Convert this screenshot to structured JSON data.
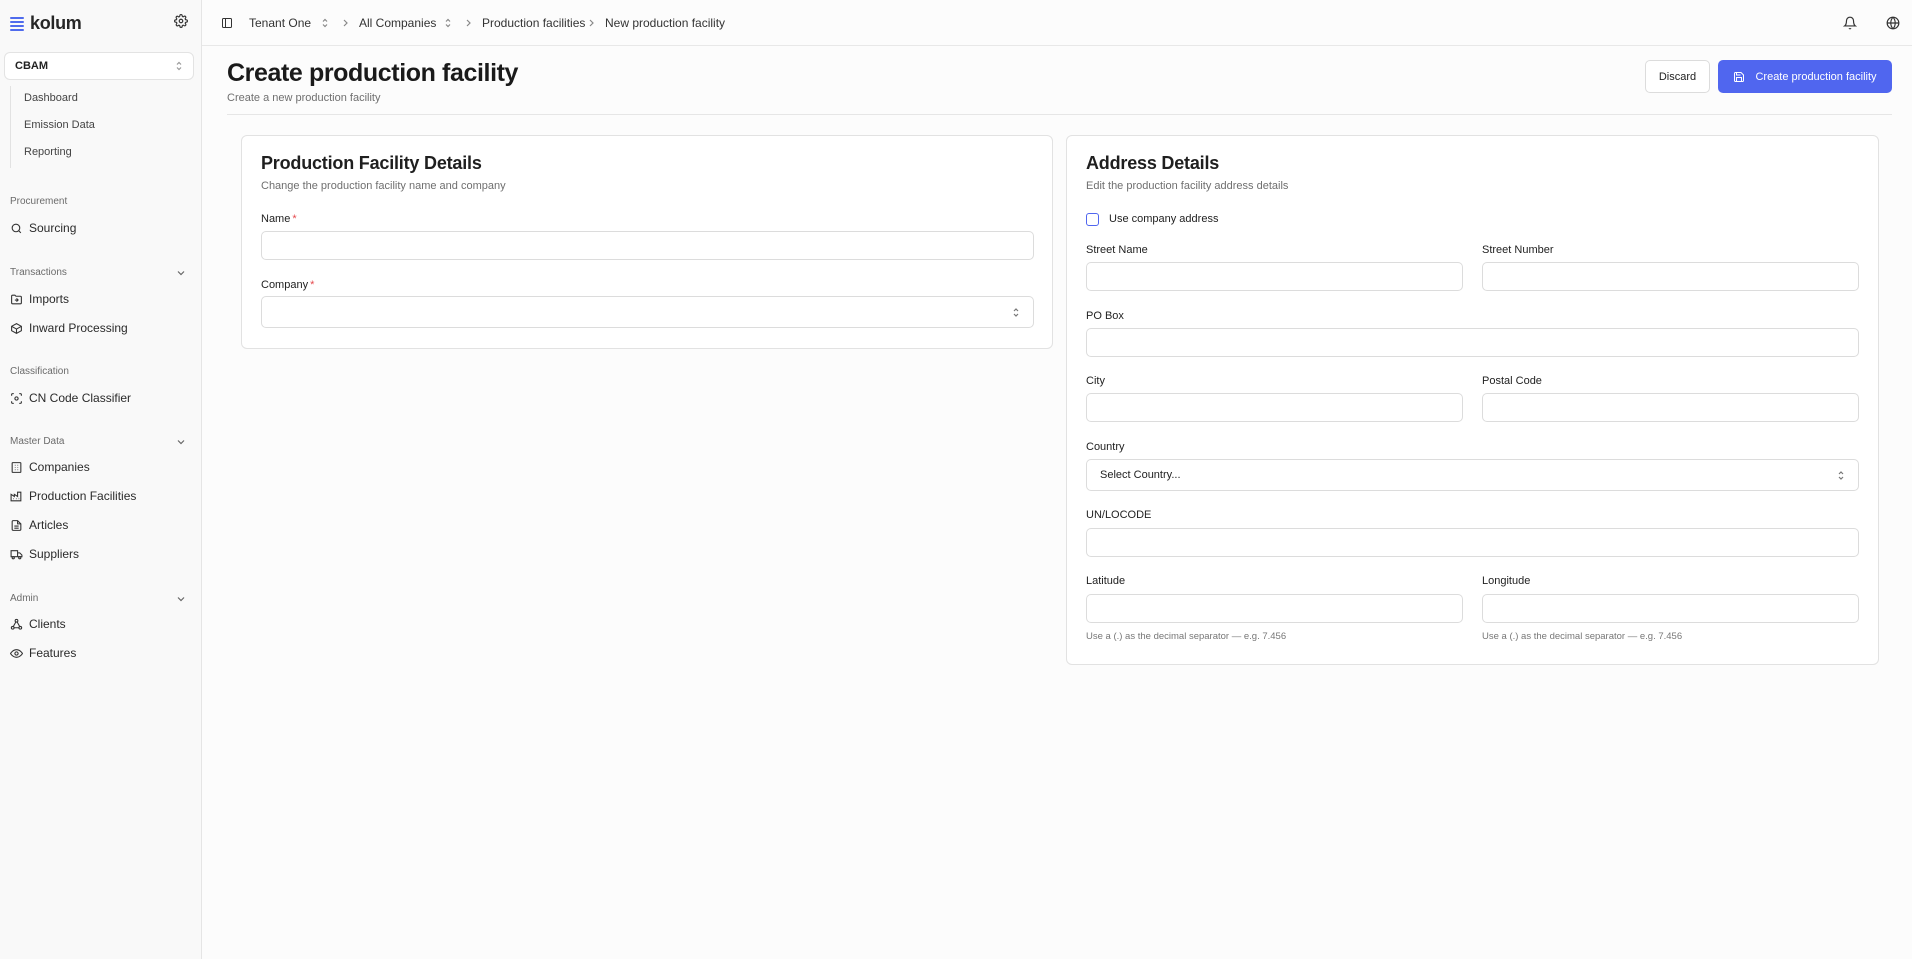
{
  "app": {
    "brand": "kolum",
    "accent": "#5066ef"
  },
  "sidebar": {
    "workspace": "CBAM",
    "sub_items": [
      "Dashboard",
      "Emission Data",
      "Reporting"
    ],
    "sections": [
      {
        "title": "Procurement",
        "items": [
          {
            "label": "Sourcing",
            "icon": "search-icon"
          }
        ]
      },
      {
        "title": "Transactions",
        "items": [
          {
            "label": "Imports",
            "icon": "folder-import-icon"
          },
          {
            "label": "Inward Processing",
            "icon": "package-icon"
          }
        ]
      },
      {
        "title": "Classification",
        "items": [
          {
            "label": "CN Code Classifier",
            "icon": "scan-icon"
          }
        ]
      },
      {
        "title": "Master Data",
        "items": [
          {
            "label": "Companies",
            "icon": "building-icon"
          },
          {
            "label": "Production Facilities",
            "icon": "factory-icon"
          },
          {
            "label": "Articles",
            "icon": "document-icon"
          },
          {
            "label": "Suppliers",
            "icon": "truck-icon"
          }
        ]
      },
      {
        "title": "Admin",
        "items": [
          {
            "label": "Clients",
            "icon": "network-icon"
          },
          {
            "label": "Features",
            "icon": "eye-icon"
          }
        ]
      }
    ]
  },
  "topbar": {
    "breadcrumbs": [
      "Tenant One",
      "All Companies",
      "Production facilities",
      "New production facility"
    ]
  },
  "header": {
    "title": "Create production facility",
    "subtitle": "Create a new production facility",
    "discard_label": "Discard",
    "create_label": "Create production facility"
  },
  "facility_card": {
    "title": "Production Facility Details",
    "description": "Change the production facility name and company",
    "name_label": "Name",
    "company_label": "Company",
    "name_value": "",
    "company_value": ""
  },
  "address_card": {
    "title": "Address Details",
    "description": "Edit the production facility address details",
    "use_company_address_label": "Use company address",
    "use_company_address_checked": false,
    "street_name_label": "Street Name",
    "street_number_label": "Street Number",
    "po_box_label": "PO Box",
    "city_label": "City",
    "postal_code_label": "Postal Code",
    "country_label": "Country",
    "country_placeholder": "Select Country...",
    "unlocode_label": "UN/LOCODE",
    "latitude_label": "Latitude",
    "longitude_label": "Longitude",
    "latitude_hint": "Use a (.) as the decimal separator — e.g. 7.456",
    "longitude_hint": "Use a (.) as the decimal separator — e.g. 7.456"
  }
}
